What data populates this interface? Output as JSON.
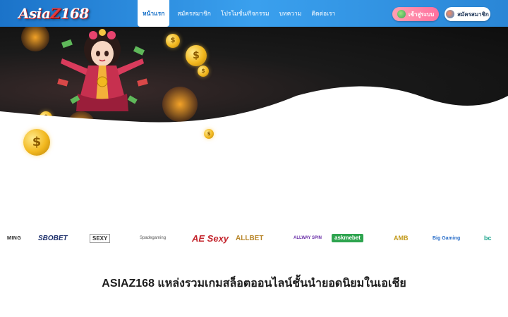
{
  "header": {
    "logo_text": "Asia",
    "logo_z": "Z",
    "logo_num": "168",
    "nav": [
      {
        "label": "หน้าแรก"
      },
      {
        "label": "สมัครสมาชิก"
      },
      {
        "label": "โปรโมชั่น/กิจกรรม"
      },
      {
        "label": "บทความ"
      },
      {
        "label": "ติดต่อเรา"
      }
    ],
    "login_label": "เข้าสู่ระบบ",
    "register_label": "สมัครสมาชิก"
  },
  "hero": {
    "coin_symbol": "$"
  },
  "providers": [
    {
      "name": "MING"
    },
    {
      "name": "SBOBET"
    },
    {
      "name": "SEXY"
    },
    {
      "name": "Spadegaming"
    },
    {
      "name": "AE Sexy"
    },
    {
      "name": "ALLBET"
    },
    {
      "name": "ALLWAY SPIN"
    },
    {
      "name": "askmebet"
    },
    {
      "name": "AMB"
    },
    {
      "name": "Big Gaming"
    },
    {
      "name": "bc"
    }
  ],
  "headline": "ASIAZ168 แหล่งรวมเกมสล็อตออนไลน์ชั้นนำยอดนิยมในเอเชีย",
  "colors": {
    "header_blue": "#1b73c9",
    "accent_pink": "#ff6f9e"
  }
}
